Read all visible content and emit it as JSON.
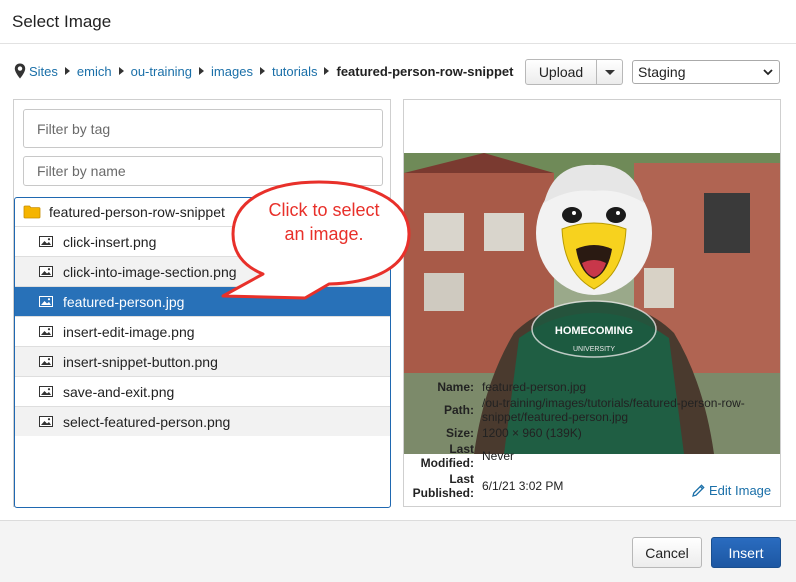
{
  "dialog": {
    "title": "Select Image"
  },
  "breadcrumb": {
    "items": [
      "Sites",
      "emich",
      "ou-training",
      "images",
      "tutorials"
    ],
    "current": "featured-person-row-snippet"
  },
  "toolbar": {
    "upload_label": "Upload",
    "environment": "Staging"
  },
  "filters": {
    "tag_placeholder": "Filter by tag",
    "name_placeholder": "Filter by name"
  },
  "tree": {
    "folder": "featured-person-row-snippet",
    "files": [
      "click-insert.png",
      "click-into-image-section.png",
      "featured-person.jpg",
      "insert-edit-image.png",
      "insert-snippet-button.png",
      "save-and-exit.png",
      "select-featured-person.png"
    ],
    "selected_index": 2
  },
  "details": {
    "name_label": "Name:",
    "name": "featured-person.jpg",
    "path_label": "Path:",
    "path_line1": "/ou-training/images/tutorials/featured-person-row-",
    "path_line2": "snippet/featured-person.jpg",
    "size_label": "Size:",
    "size": "1200 × 960 (139K)",
    "modified_label_1": "Last",
    "modified_label_2": "Modified:",
    "modified": "Never",
    "published_label_1": "Last",
    "published_label_2": "Published:",
    "published": "6/1/21 3:02 PM",
    "edit_label": "Edit Image"
  },
  "preview": {
    "shirt_text": "HOMECOMING",
    "shirt_subtext": "UNIVERSITY"
  },
  "callout": {
    "line1": "Click to select",
    "line2": "an image."
  },
  "footer": {
    "cancel_label": "Cancel",
    "insert_label": "Insert"
  },
  "colors": {
    "link": "#1a6fa8",
    "selection": "#2871b8",
    "primary": "#1d57a3",
    "callout": "#e8302a"
  }
}
